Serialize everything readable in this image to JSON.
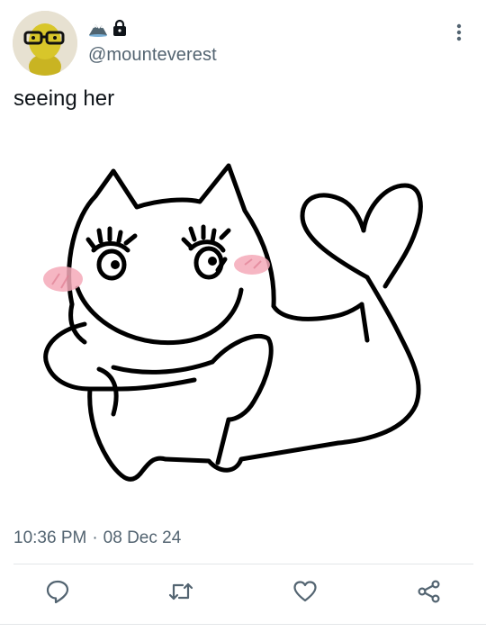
{
  "tweet": {
    "handle": "@mounteverest",
    "name_icons": [
      "mountain-icon",
      "lock-icon"
    ],
    "text": "seeing her",
    "time": "10:36 PM",
    "separator": "·",
    "date": "08 Dec 24"
  },
  "actions": [
    "reply-icon",
    "retweet-icon",
    "like-icon",
    "share-icon"
  ],
  "colors": {
    "secondary_text": "#536471",
    "icon": "#536471",
    "divider": "#e3e6e8",
    "blush": "#f4a9b8"
  }
}
